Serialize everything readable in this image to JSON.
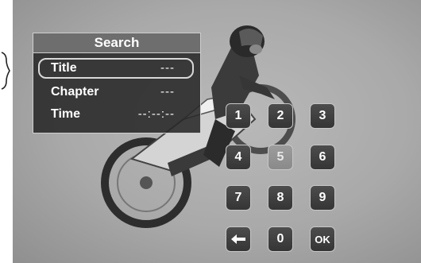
{
  "search_panel": {
    "title": "Search",
    "fields": [
      {
        "label": "Title",
        "value": "---",
        "selected": true
      },
      {
        "label": "Chapter",
        "value": "---",
        "selected": false
      },
      {
        "label": "Time",
        "value": "--:--:--",
        "selected": false
      }
    ]
  },
  "keypad": {
    "keys": [
      "1",
      "2",
      "3",
      "4",
      "5",
      "6",
      "7",
      "8",
      "9",
      "",
      "0",
      "OK"
    ],
    "focused_key": "5",
    "backspace_icon": "left-arrow-icon"
  },
  "colors": {
    "panel_bg": "#282828",
    "panel_header": "#6e6e6e",
    "key_bg": "#3f3f3f",
    "key_focused_bg": "#939393",
    "border": "#cfcfcf"
  }
}
